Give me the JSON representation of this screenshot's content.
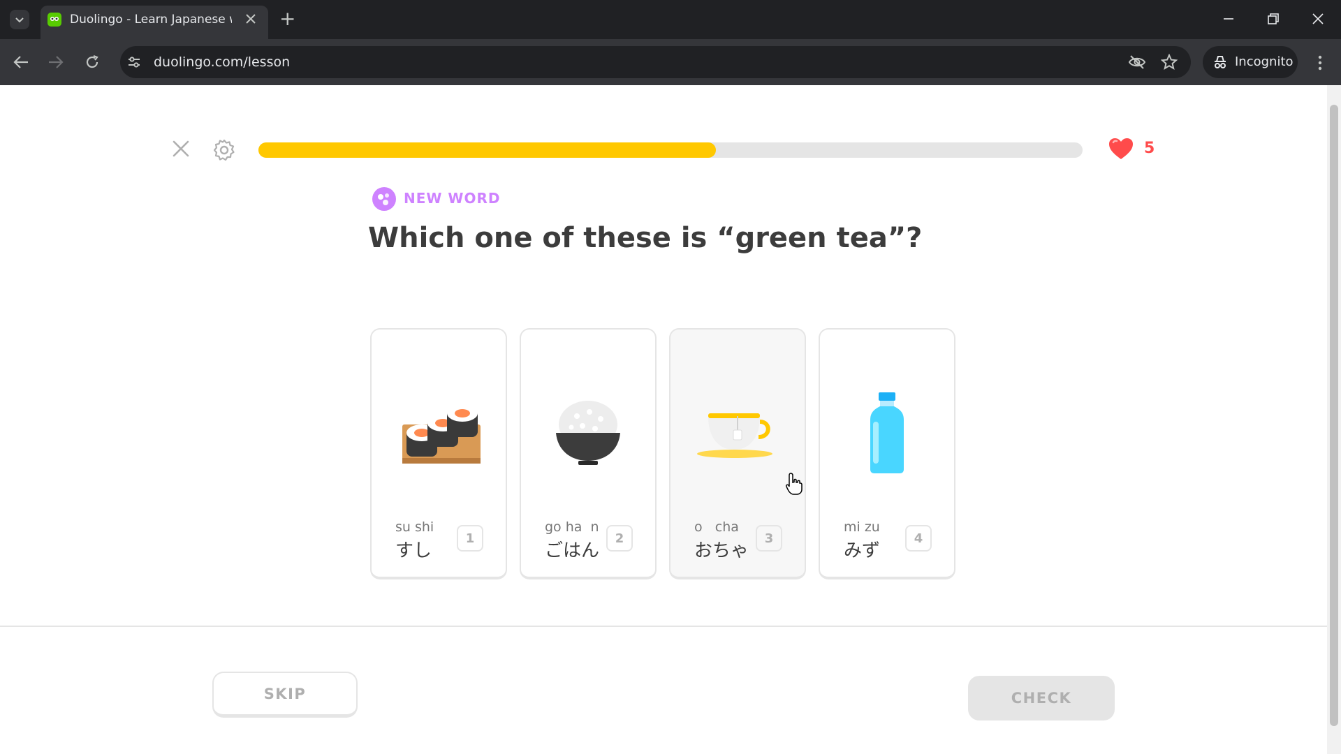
{
  "browser": {
    "tab_title": "Duolingo - Learn Japanese with",
    "url": "duolingo.com/lesson",
    "incognito_label": "Incognito",
    "new_tab_symbol": "+",
    "colors": {
      "tabstrip": "#202124",
      "toolbar": "#35363a"
    }
  },
  "lesson": {
    "progress_fraction": 0.555,
    "hearts": "5",
    "badge": "NEW WORD",
    "question": "Which one of these is “green tea”?",
    "choices": [
      {
        "romaji": "su shi",
        "kana": "すし",
        "number": "1",
        "icon": "sushi-icon"
      },
      {
        "romaji": "go ha  n",
        "kana": "ごはん",
        "number": "2",
        "icon": "rice-bowl-icon"
      },
      {
        "romaji": "o   cha",
        "kana": "おちゃ",
        "number": "3",
        "icon": "tea-cup-icon"
      },
      {
        "romaji": "mi zu",
        "kana": "みず",
        "number": "4",
        "icon": "water-bottle-icon"
      }
    ],
    "skip_label": "SKIP",
    "check_label": "CHECK",
    "colors": {
      "progress": "#ffc800",
      "heart": "#ff4b4b",
      "badge": "#ce82ff"
    }
  }
}
